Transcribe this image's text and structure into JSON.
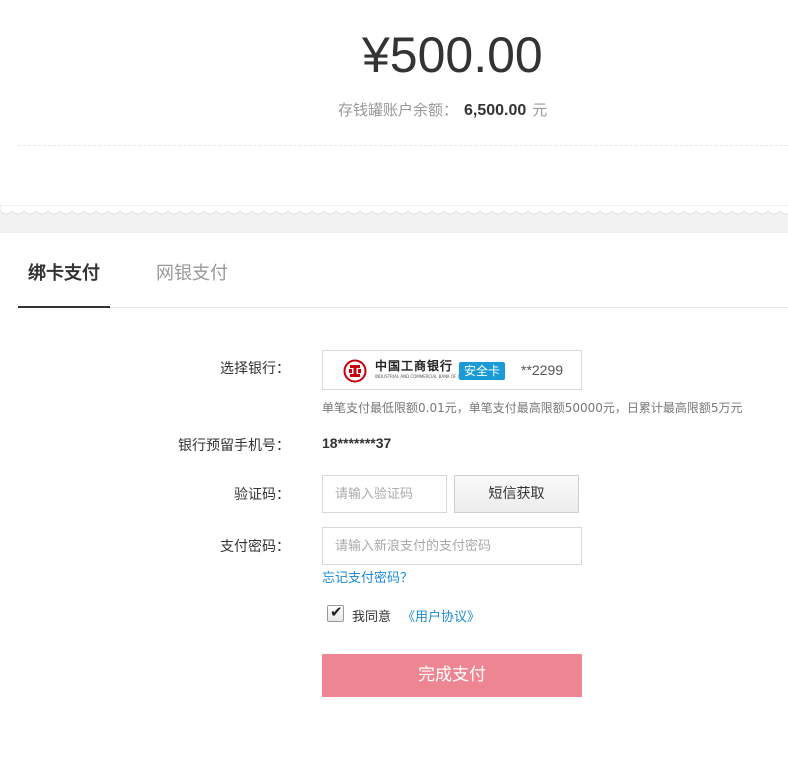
{
  "summary": {
    "amount": "¥500.00",
    "balance_label": "存钱罐账户余额：",
    "balance_value": "6,500.00",
    "balance_unit": "元"
  },
  "tabs": [
    {
      "label": "绑卡支付",
      "active": true
    },
    {
      "label": "网银支付",
      "active": false
    }
  ],
  "form": {
    "bank_label": "选择银行：",
    "bank_name": "中国工商银行",
    "bank_name_en": "INDUSTRIAL AND COMMERCIAL BANK OF CHINA",
    "safe_badge": "安全卡",
    "card_tail": "**2299",
    "limit_note": "单笔支付最低限额0.01元，单笔支付最高限额50000元，日累计最高限额5万元",
    "phone_label": "银行预留手机号：",
    "phone_value": "18*******37",
    "code_label": "验证码：",
    "code_placeholder": "请输入验证码",
    "sms_button": "短信获取",
    "pwd_label": "支付密码：",
    "pwd_placeholder": "请输入新浪支付的支付密码",
    "forgot_link": "忘记支付密码？",
    "agree_text": "我同意",
    "agree_link": "《用户协议》",
    "agree_checked": true,
    "submit_label": "完成支付"
  },
  "colors": {
    "accent_link": "#1a8bd6",
    "submit_bg": "#ee8592",
    "badge_bg": "#1a9bd7",
    "bank_logo": "#c7000b"
  },
  "icons": {
    "bank_logo": "icbc-logo-icon",
    "checkbox": "checkmark-icon"
  }
}
